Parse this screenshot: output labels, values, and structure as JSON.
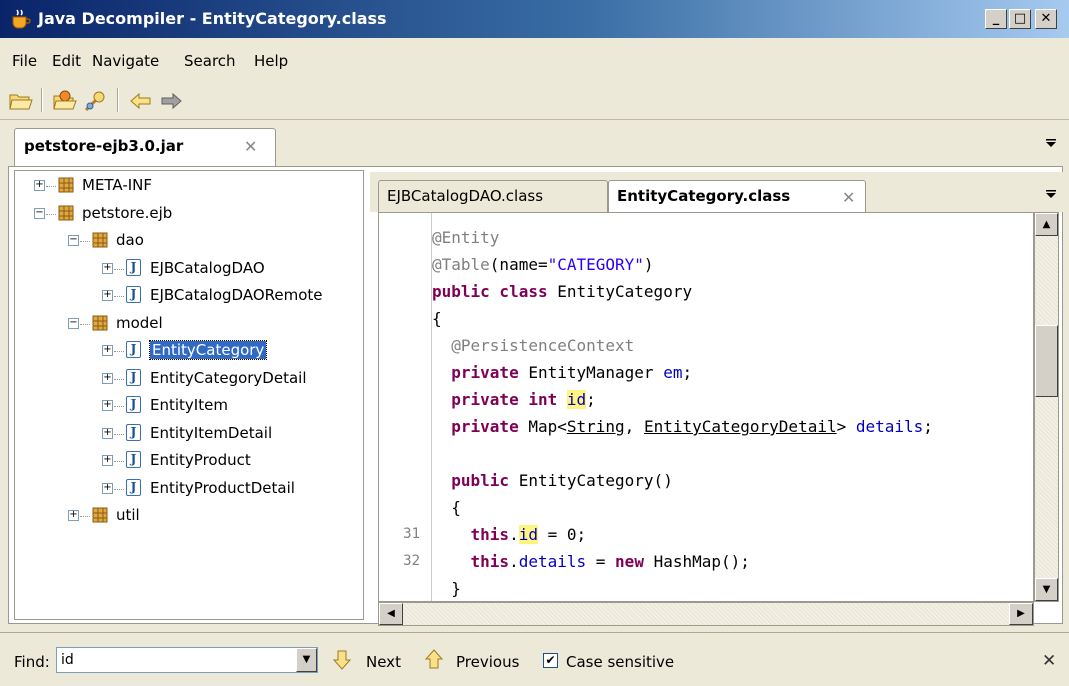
{
  "window": {
    "title": "Java Decompiler - EntityCategory.class",
    "controls": {
      "minimize": "_",
      "maximize": "□",
      "close": "✕"
    }
  },
  "menu": [
    "File",
    "Edit",
    "Navigate",
    "Search",
    "Help"
  ],
  "toolbar": {
    "icons": [
      "open-file-icon",
      "open-type-icon",
      "search-icon",
      "back-icon",
      "forward-icon"
    ]
  },
  "outer_tab": {
    "label": "petstore-ejb3.0.jar",
    "close": "✕"
  },
  "tree": [
    {
      "label": "META-INF",
      "kind": "package",
      "depth": 0,
      "expander": "+"
    },
    {
      "label": "petstore.ejb",
      "kind": "package",
      "depth": 0,
      "expander": "−"
    },
    {
      "label": "dao",
      "kind": "package",
      "depth": 1,
      "expander": "−"
    },
    {
      "label": "EJBCatalogDAO",
      "kind": "class",
      "depth": 2,
      "expander": "+"
    },
    {
      "label": "EJBCatalogDAORemote",
      "kind": "class",
      "depth": 2,
      "expander": "+"
    },
    {
      "label": "model",
      "kind": "package",
      "depth": 1,
      "expander": "−"
    },
    {
      "label": "EntityCategory",
      "kind": "class",
      "depth": 2,
      "expander": "+",
      "selected": true
    },
    {
      "label": "EntityCategoryDetail",
      "kind": "class",
      "depth": 2,
      "expander": "+"
    },
    {
      "label": "EntityItem",
      "kind": "class",
      "depth": 2,
      "expander": "+"
    },
    {
      "label": "EntityItemDetail",
      "kind": "class",
      "depth": 2,
      "expander": "+"
    },
    {
      "label": "EntityProduct",
      "kind": "class",
      "depth": 2,
      "expander": "+"
    },
    {
      "label": "EntityProductDetail",
      "kind": "class",
      "depth": 2,
      "expander": "+"
    },
    {
      "label": "util",
      "kind": "package",
      "depth": 1,
      "expander": "+"
    }
  ],
  "editor_tabs": [
    {
      "label": "EJBCatalogDAO.class",
      "active": false
    },
    {
      "label": "EntityCategory.class",
      "active": true,
      "close": "✕"
    }
  ],
  "code": [
    {
      "num": "",
      "tokens": [
        [
          "ann",
          "@Entity"
        ]
      ]
    },
    {
      "num": "",
      "tokens": [
        [
          "ann",
          "@Table"
        ],
        [
          "",
          "(name="
        ],
        [
          "str",
          "\"CATEGORY\""
        ],
        [
          "",
          ")"
        ]
      ]
    },
    {
      "num": "",
      "tokens": [
        [
          "kw",
          "public class"
        ],
        [
          "",
          " EntityCategory"
        ]
      ]
    },
    {
      "num": "",
      "tokens": [
        [
          "",
          "{"
        ]
      ]
    },
    {
      "num": "",
      "tokens": [
        [
          "",
          "  "
        ],
        [
          "ann",
          "@PersistenceContext"
        ]
      ]
    },
    {
      "num": "",
      "tokens": [
        [
          "",
          "  "
        ],
        [
          "kw",
          "private"
        ],
        [
          "",
          " EntityManager "
        ],
        [
          "fld",
          "em"
        ],
        [
          "",
          ";"
        ]
      ]
    },
    {
      "num": "",
      "tokens": [
        [
          "",
          "  "
        ],
        [
          "kw",
          "private int"
        ],
        [
          "",
          " "
        ],
        [
          "fld hl",
          "id"
        ],
        [
          "",
          ";"
        ]
      ]
    },
    {
      "num": "",
      "tokens": [
        [
          "",
          "  "
        ],
        [
          "kw",
          "private"
        ],
        [
          "",
          " Map<"
        ],
        [
          "ul",
          "String"
        ],
        [
          "",
          ", "
        ],
        [
          "ul",
          "EntityCategoryDetail"
        ],
        [
          "",
          "> "
        ],
        [
          "fld",
          "details"
        ],
        [
          "",
          ";"
        ]
      ]
    },
    {
      "num": "",
      "tokens": [
        [
          "",
          ""
        ]
      ]
    },
    {
      "num": "",
      "tokens": [
        [
          "",
          "  "
        ],
        [
          "kw",
          "public"
        ],
        [
          "",
          " EntityCategory()"
        ]
      ]
    },
    {
      "num": "",
      "tokens": [
        [
          "",
          "  {"
        ]
      ]
    },
    {
      "num": "31",
      "tokens": [
        [
          "",
          "    "
        ],
        [
          "kw",
          "this"
        ],
        [
          "",
          "."
        ],
        [
          "fld hl",
          "id"
        ],
        [
          "",
          " = 0;"
        ]
      ]
    },
    {
      "num": "32",
      "tokens": [
        [
          "",
          "    "
        ],
        [
          "kw",
          "this"
        ],
        [
          "",
          "."
        ],
        [
          "fld",
          "details"
        ],
        [
          "",
          " = "
        ],
        [
          "kw",
          "new"
        ],
        [
          "",
          " HashMap();"
        ]
      ]
    },
    {
      "num": "",
      "tokens": [
        [
          "",
          "  }"
        ]
      ]
    }
  ],
  "findbar": {
    "label": "Find:",
    "value": "id",
    "next": "Next",
    "previous": "Previous",
    "case_sensitive": "Case sensitive",
    "case_checked": true,
    "close": "✕"
  }
}
